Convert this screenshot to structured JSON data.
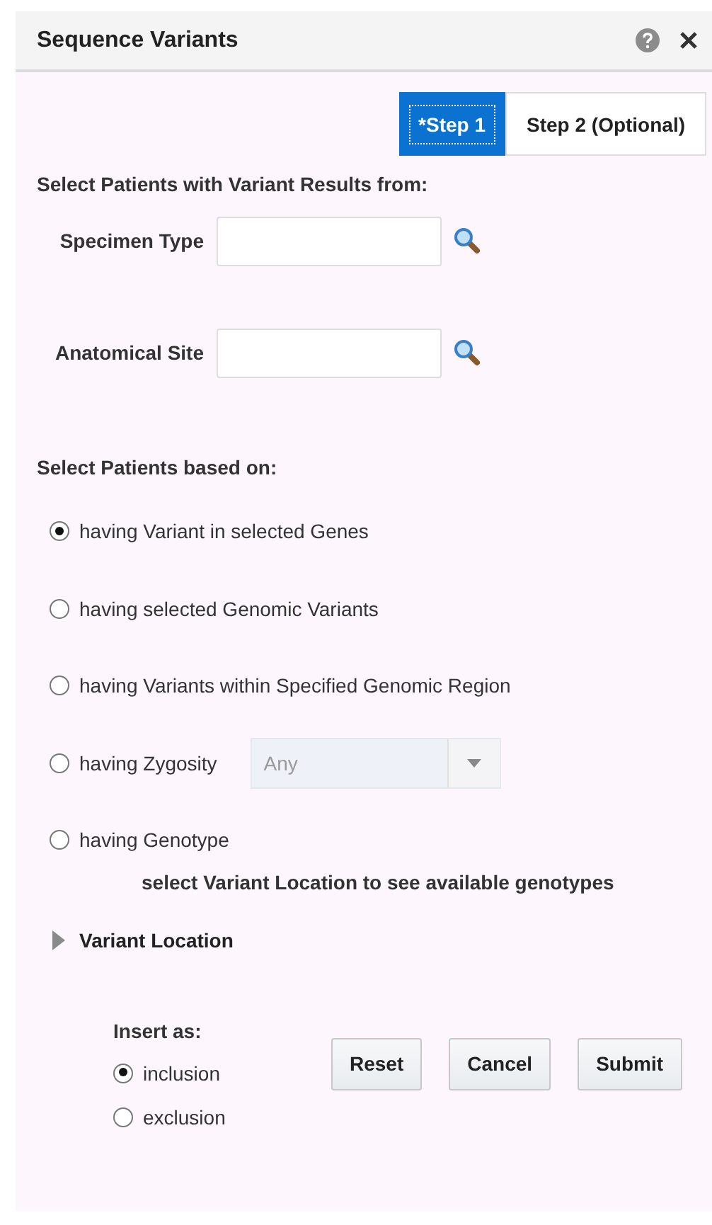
{
  "window": {
    "title": "Sequence Variants"
  },
  "tabs": [
    {
      "label": "*Step 1",
      "selected": true
    },
    {
      "label": "Step 2 (Optional)",
      "selected": false
    }
  ],
  "source": {
    "heading": "Select Patients with Variant Results from:",
    "fields": [
      {
        "label": "Specimen Type"
      },
      {
        "label": "Anatomical Site"
      }
    ]
  },
  "criteria": {
    "heading": "Select Patients based on:",
    "options": [
      {
        "label": "having Variant in selected Genes",
        "selected": true,
        "kind": "plain"
      },
      {
        "label": "having selected Genomic Variants",
        "selected": false,
        "kind": "plain"
      },
      {
        "label": "having Variants within Specified Genomic Region",
        "selected": false,
        "kind": "plain"
      },
      {
        "label": "having Zygosity",
        "selected": false,
        "kind": "select",
        "value": "Any",
        "disabled": true
      },
      {
        "label": "having Genotype",
        "selected": false,
        "kind": "plain"
      }
    ],
    "hint": "select Variant Location to see available genotypes"
  },
  "variant_location": {
    "label": "Variant Location",
    "expanded": false
  },
  "insert_as": {
    "label": "Insert as:",
    "options": [
      {
        "label": "inclusion",
        "selected": true
      },
      {
        "label": "exclusion",
        "selected": false
      }
    ]
  },
  "buttons": [
    "Reset",
    "Cancel",
    "Submit"
  ]
}
